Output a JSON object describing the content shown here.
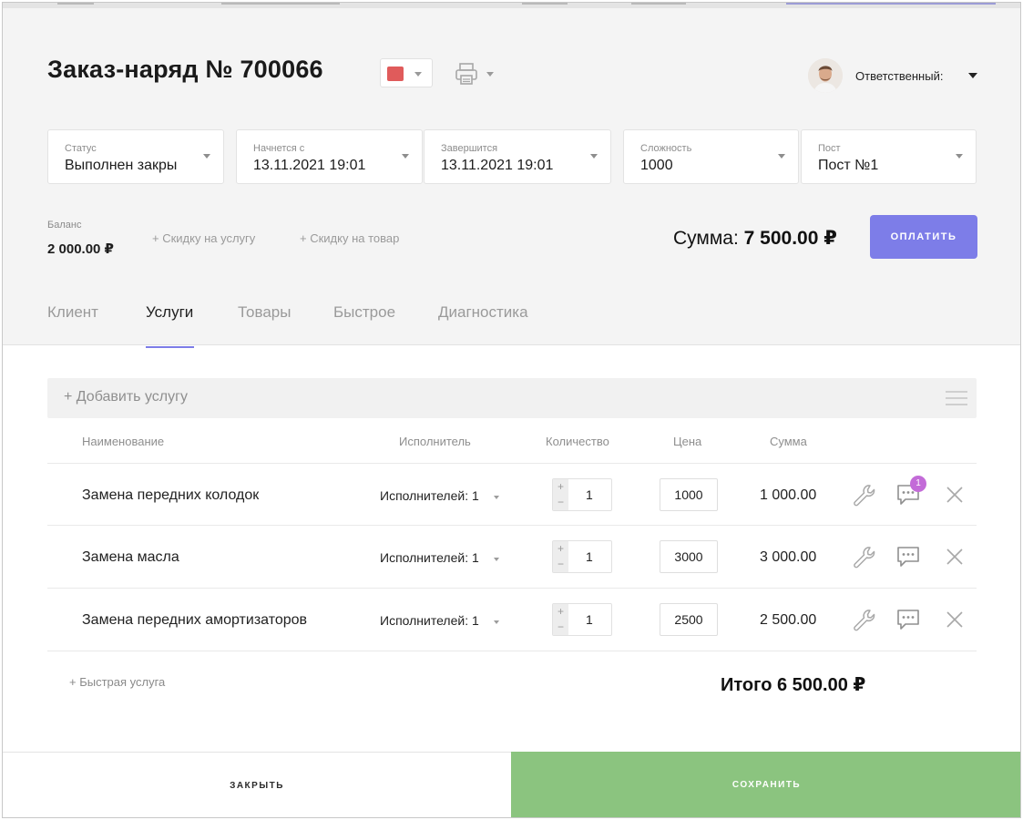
{
  "header": {
    "title": "Заказ-наряд № 700066",
    "order_color": "#e05b5b",
    "responsible_label": "Ответственный:"
  },
  "fields": [
    {
      "label": "Статус",
      "value": "Выполнен закры"
    },
    {
      "label": "Начнется с",
      "value": "13.11.2021 19:01"
    },
    {
      "label": "Завершится",
      "value": "13.11.2021 19:01"
    },
    {
      "label": "Сложность",
      "value": "1000"
    },
    {
      "label": "Пост",
      "value": "Пост №1"
    }
  ],
  "balance": {
    "label": "Баланс",
    "value": "2 000.00 ₽",
    "discount_service": "+ Скидку на услугу",
    "discount_goods": "+ Скидку на товар"
  },
  "summary": {
    "sum_label": "Сумма:",
    "sum_value": "7 500.00 ₽",
    "pay_label": "ОПЛАТИТЬ"
  },
  "tabs": [
    {
      "label": "Клиент",
      "active": false
    },
    {
      "label": "Услуги",
      "active": true
    },
    {
      "label": "Товары",
      "active": false
    },
    {
      "label": "Быстрое",
      "active": false
    },
    {
      "label": "Диагностика",
      "active": false
    }
  ],
  "services": {
    "add_placeholder": "+ Добавить услугу",
    "columns": [
      "Наименование",
      "Исполнитель",
      "Количество",
      "Цена",
      "Сумма"
    ],
    "rows": [
      {
        "name": "Замена передних колодок",
        "performer": "Исполнителей: 1",
        "qty": "1",
        "price": "1000",
        "sum": "1 000.00",
        "comment_badge": "1"
      },
      {
        "name": "Замена масла",
        "performer": "Исполнителей: 1",
        "qty": "1",
        "price": "3000",
        "sum": "3 000.00"
      },
      {
        "name": "Замена передних амортизаторов",
        "performer": "Исполнителей: 1",
        "qty": "1",
        "price": "2500",
        "sum": "2 500.00"
      }
    ],
    "quick_service": "+ Быстрая услуга",
    "total": "Итого 6 500.00 ₽"
  },
  "footer": {
    "close_label": "ЗАКРЫТЬ",
    "save_label": "СОХРАНИТЬ"
  },
  "colors": {
    "accent": "#7d7de8",
    "save": "#8bc47f",
    "badge": "#c36bd8"
  }
}
